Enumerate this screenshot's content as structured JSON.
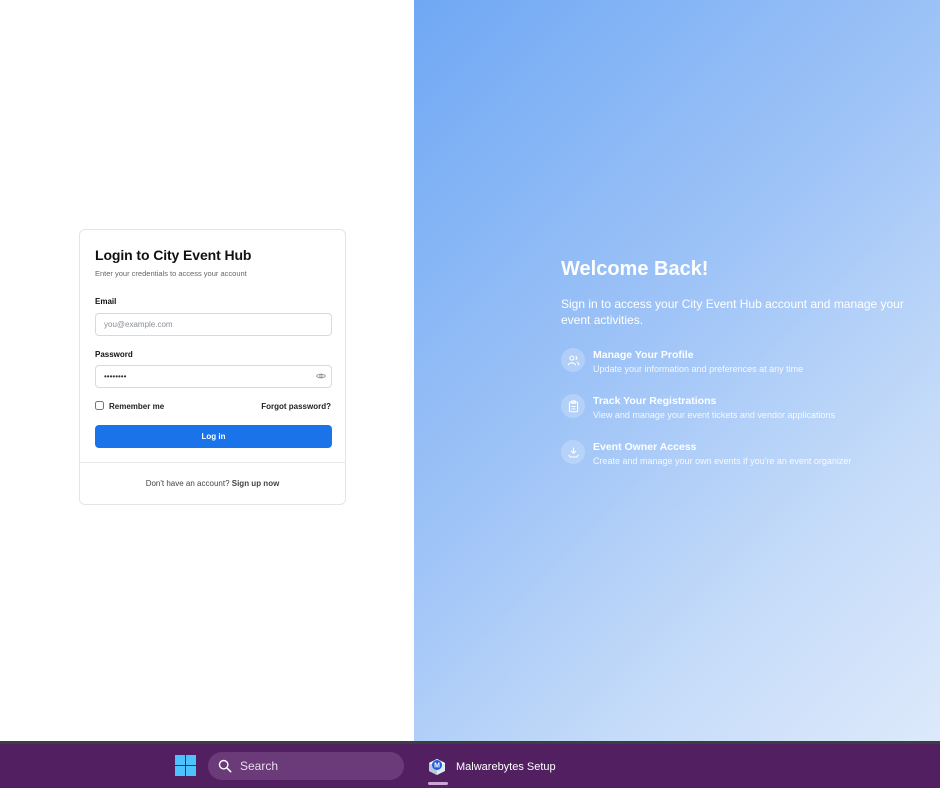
{
  "login": {
    "title": "Login to City Event Hub",
    "subtitle": "Enter your credentials to access your account",
    "email_label": "Email",
    "email_placeholder": "you@example.com",
    "password_label": "Password",
    "password_value": "••••••••",
    "remember_label": "Remember me",
    "forgot_label": "Forgot password?",
    "login_button": "Log in",
    "signup_prompt": "Don't have an account?",
    "signup_link": "Sign up now"
  },
  "welcome": {
    "title": "Welcome Back!",
    "text": "Sign in to access your City Event Hub account and manage your event activities.",
    "features": [
      {
        "icon": "users-icon",
        "title": "Manage Your Profile",
        "desc": "Update your information and preferences at any time"
      },
      {
        "icon": "clipboard-icon",
        "title": "Track Your Registrations",
        "desc": "View and manage your event tickets and vendor applications"
      },
      {
        "icon": "event-owner-icon",
        "title": "Event Owner Access",
        "desc": "Create and manage your own events if you're an event organizer"
      }
    ]
  },
  "taskbar": {
    "search_label": "Search",
    "app_label": "Malwarebytes Setup"
  },
  "colors": {
    "primary_button": "#1a73e8",
    "taskbar": "#522060",
    "gradient_start": "#6fa8f4",
    "gradient_end": "#dde9fb"
  }
}
